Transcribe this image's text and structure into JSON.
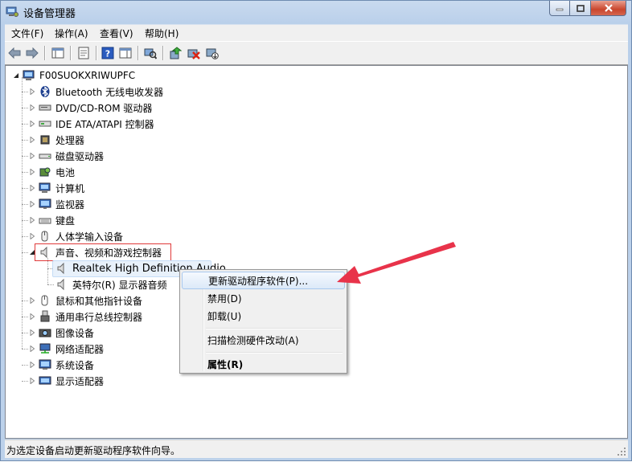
{
  "window": {
    "title": "设备管理器",
    "caption": {
      "minimize": "—",
      "maximize": "□",
      "close": "✕"
    }
  },
  "menu": [
    "文件(F)",
    "操作(A)",
    "查看(V)",
    "帮助(H)"
  ],
  "toolbar_icons": [
    "back-arrow-icon",
    "forward-arrow-icon",
    "console-tree-icon",
    "properties-icon",
    "help-icon",
    "action-pane-icon",
    "scan-hardware-icon",
    "update-driver-icon",
    "uninstall-icon",
    "disable-icon"
  ],
  "tree": {
    "root": "F00SUOKXRIWUPFC",
    "categories": [
      {
        "label": "Bluetooth 无线电收发器",
        "icon": "bluetooth-icon"
      },
      {
        "label": "DVD/CD-ROM 驱动器",
        "icon": "dvd-drive-icon"
      },
      {
        "label": "IDE ATA/ATAPI 控制器",
        "icon": "ide-controller-icon"
      },
      {
        "label": "处理器",
        "icon": "processor-icon"
      },
      {
        "label": "磁盘驱动器",
        "icon": "disk-drive-icon"
      },
      {
        "label": "电池",
        "icon": "battery-icon"
      },
      {
        "label": "计算机",
        "icon": "computer-icon"
      },
      {
        "label": "监视器",
        "icon": "monitor-icon"
      },
      {
        "label": "键盘",
        "icon": "keyboard-icon"
      },
      {
        "label": "人体学输入设备",
        "icon": "hid-icon"
      },
      {
        "label": "声音、视频和游戏控制器",
        "icon": "speaker-icon",
        "expanded": true
      },
      {
        "label": "鼠标和其他指针设备",
        "icon": "mouse-icon"
      },
      {
        "label": "通用串行总线控制器",
        "icon": "usb-icon"
      },
      {
        "label": "图像设备",
        "icon": "camera-icon"
      },
      {
        "label": "网络适配器",
        "icon": "network-adapter-icon"
      },
      {
        "label": "系统设备",
        "icon": "system-device-icon"
      },
      {
        "label": "显示适配器",
        "icon": "display-adapter-icon"
      }
    ],
    "children": [
      "Realtek High Definition Audio",
      "英特尔(R) 显示器音频"
    ]
  },
  "context_menu": {
    "items": [
      "更新驱动程序软件(P)...",
      "禁用(D)",
      "卸载(U)",
      "扫描检测硬件改动(A)",
      "属性(R)"
    ]
  },
  "status_bar": "为选定设备启动更新驱动程序软件向导。",
  "colors": {
    "highlight_box": "#e03a3a",
    "annotation_arrow": "#e8334a"
  }
}
